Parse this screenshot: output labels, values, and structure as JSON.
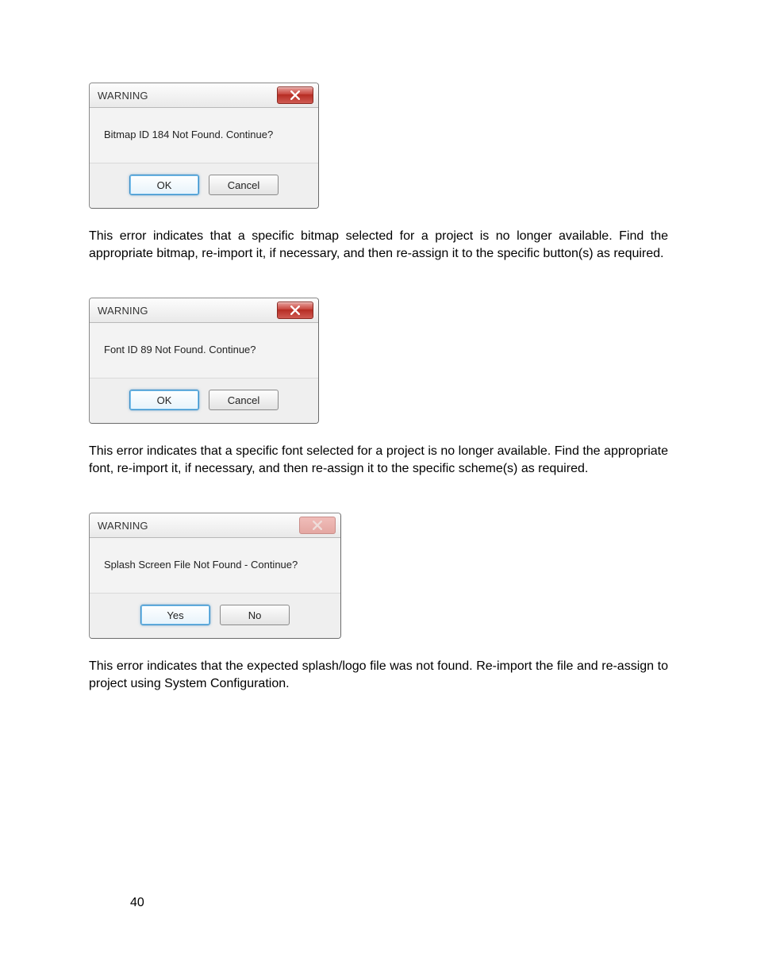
{
  "dialogs": [
    {
      "title": "WARNING",
      "message": "Bitmap ID 184 Not Found.  Continue?",
      "close_enabled": true,
      "wide": false,
      "buttons": [
        {
          "label": "OK",
          "default": true
        },
        {
          "label": "Cancel",
          "default": false
        }
      ]
    },
    {
      "title": "WARNING",
      "message": "Font ID 89 Not Found.  Continue?",
      "close_enabled": true,
      "wide": false,
      "buttons": [
        {
          "label": "OK",
          "default": true
        },
        {
          "label": "Cancel",
          "default": false
        }
      ]
    },
    {
      "title": "WARNING",
      "message": "Splash Screen File Not Found - Continue?",
      "close_enabled": false,
      "wide": true,
      "buttons": [
        {
          "label": "Yes",
          "default": true
        },
        {
          "label": "No",
          "default": false
        }
      ]
    }
  ],
  "paragraphs": [
    "This error indicates that a specific bitmap selected for a project is no longer available. Find the appropriate bitmap, re-import it, if necessary, and then re-assign it to the specific button(s) as required.",
    "This error indicates that a specific font selected for a project is no longer available. Find the appropriate font, re-import it, if necessary, and then re-assign it to the specific scheme(s) as required.",
    "This error indicates that the expected splash/logo file was not found. Re-import the file and re-assign to project using System Configuration."
  ],
  "page_number": "40"
}
